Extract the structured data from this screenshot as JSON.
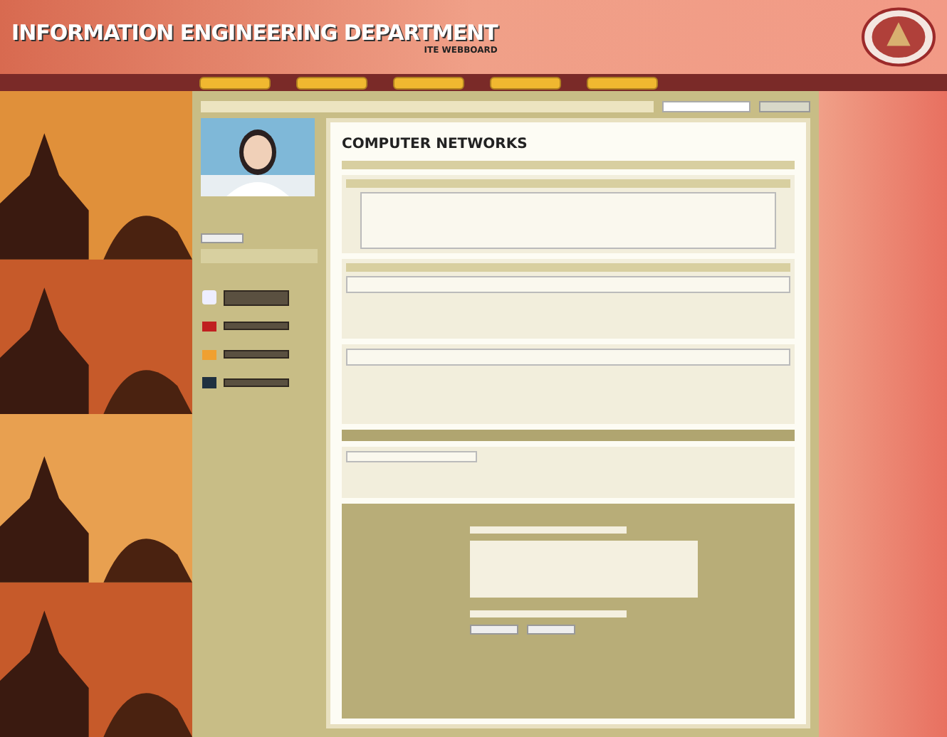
{
  "header": {
    "title": "INFORMATION ENGINEERING DEPARTMENT",
    "subtitle": "ITE WEBBOARD"
  },
  "content": {
    "course_title": "COMPUTER NETWORKS"
  }
}
